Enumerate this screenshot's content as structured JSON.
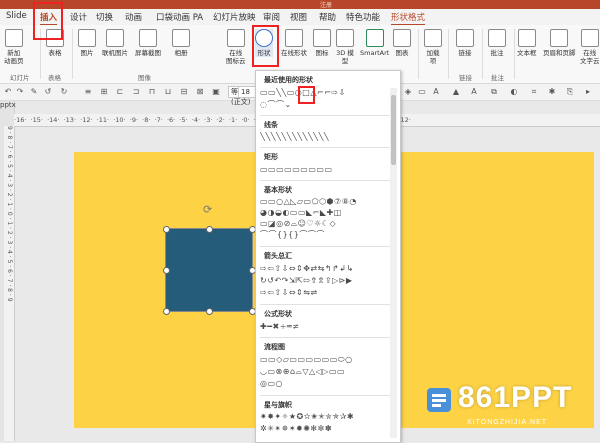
{
  "titlebar": {
    "left_text": "",
    "right_text": "注册"
  },
  "tabs": [
    {
      "label": "Slide",
      "active": false
    },
    {
      "label": "插入",
      "active": true
    },
    {
      "label": "设计",
      "active": false
    },
    {
      "label": "切换",
      "active": false
    },
    {
      "label": "动画",
      "active": false
    },
    {
      "label": "口袋动画 PA",
      "active": false
    },
    {
      "label": "幻灯片放映",
      "active": false
    },
    {
      "label": "审阅",
      "active": false
    },
    {
      "label": "视图",
      "active": false
    },
    {
      "label": "帮助",
      "active": false
    },
    {
      "label": "特色功能",
      "active": false
    },
    {
      "label": "形状格式",
      "active": false
    }
  ],
  "ribbon": {
    "buttons": [
      {
        "label": "新加\n动画页"
      },
      {
        "label": "表格"
      },
      {
        "label": "图片"
      },
      {
        "label": "联机图片"
      },
      {
        "label": "屏幕截图"
      },
      {
        "label": "相册"
      },
      {
        "label": "在线\n图标云"
      },
      {
        "label": "形状"
      },
      {
        "label": "在线形状"
      },
      {
        "label": "图标"
      },
      {
        "label": "3D 模\n型"
      },
      {
        "label": "SmartArt"
      },
      {
        "label": "图表"
      },
      {
        "label": "加载\n项"
      },
      {
        "label": "链接"
      },
      {
        "label": "批注"
      },
      {
        "label": "文本框"
      },
      {
        "label": "页眉和页脚"
      },
      {
        "label": "在线\n文字云"
      }
    ],
    "groups": [
      "幻灯片",
      "表格",
      "图像",
      "链接",
      "批注"
    ]
  },
  "toolbar": {
    "font_name": "等线 (正文)",
    "font_size": "18",
    "doc_tab": "pptx"
  },
  "ruler": {
    "horizontal": "·16·  ·15·  ·14·  ·13·  ·12·  ·11·  ·10·  ·9·  ·8·  ·7·  ·6·  ·5·  ·4·  ·3·  ·2·  ·1·  ·0·  ·1·  ·2·  ·3·  ·4·  ·5·  ·6·  ·7·  ·8·  ·9·  ·10·  ·11·  ·12·",
    "vertical": "9 · 8 · 7 · 6 · 5 · 4 · 3 · 2 · 1 · 0 · 1 · 2 · 3 · 4 · 5 · 6 · 7 · 8 · 9"
  },
  "shapes_menu": {
    "sections": [
      {
        "title": "最近使用的形状",
        "rows": [
          "▭▭╲╲▭○□△⌐⌐⇨⇩",
          "◌⌒⌒⌄"
        ]
      },
      {
        "title": "线条",
        "rows": [
          "╲╲╲╲╲╲╲╲╲╲╲╲╲"
        ]
      },
      {
        "title": "矩形",
        "rows": [
          "▭▭▭▭▭▭▭▭▭"
        ]
      },
      {
        "title": "基本形状",
        "rows": [
          "▭▭○△◺▱▭⬠⬡⬢⑦⑧◔",
          "◕◑◒◐▭▭◣⌐◣✚◫",
          "▭◪◎⊘⌓☺♡☼☾◇",
          "⌒⌒{}{}⌒⌒⌒"
        ]
      },
      {
        "title": "箭头总汇",
        "rows": [
          "⇨⇦⇧⇩⇔⇕✥⇄⇆↰↱↲↳",
          "↻↺↶↷⇲⇱⇰⇮⇯⇪▷⊳▶",
          "⇨⇦⇧⇩⇔⇕⇋⇌"
        ]
      },
      {
        "title": "公式形状",
        "rows": [
          "✚━✖÷═≠"
        ]
      },
      {
        "title": "流程图",
        "rows": [
          "▭▭◇▱▭▭▭▭▭▭⬭○",
          "◡▭⊗⊕⌂⌓▽△◁▷▭▭",
          "◎▭○"
        ]
      },
      {
        "title": "星与旗帜",
        "rows": [
          "✷✸✦✧★✪✫✬✭✮✯✰✱",
          "✲✳✴✵✶✹✺✻✼✽"
        ]
      }
    ]
  },
  "watermark": {
    "text": "861PPT",
    "url": "XITONGZHIJIA.NET"
  },
  "colors": {
    "slide_bg": "#fdd244",
    "shape_fill": "#255c7a",
    "accent": "#b7472a",
    "highlight": "#e22222"
  }
}
